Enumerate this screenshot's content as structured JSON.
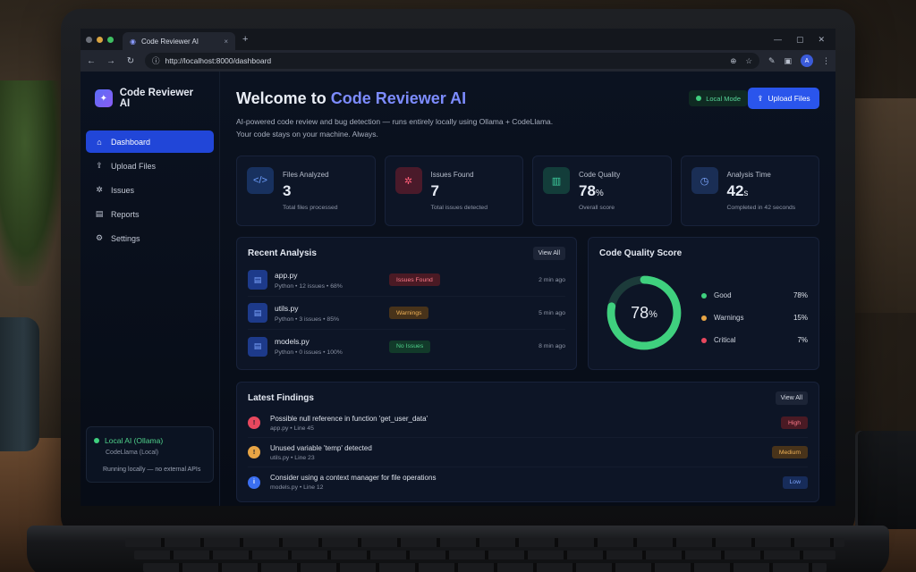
{
  "browser": {
    "tab_title": "Code Reviewer AI",
    "tab_close": "×",
    "new_tab": "+",
    "url": "http://localhost:8000/dashboard",
    "avatar_initial": "A"
  },
  "sidebar": {
    "brand": "Code Reviewer AI",
    "items": [
      {
        "label": "Dashboard"
      },
      {
        "label": "Upload Files"
      },
      {
        "label": "Issues"
      },
      {
        "label": "Reports"
      },
      {
        "label": "Settings"
      }
    ],
    "status": {
      "title": "Local AI (Ollama)",
      "model": "CodeLlama (Local)",
      "note": "Running locally — no external APIs"
    }
  },
  "header": {
    "title_prefix": "Welcome to ",
    "title_accent": "Code Reviewer AI",
    "subtitle_line1": "AI-powered code review and bug detection — runs entirely locally using Ollama + CodeLlama.",
    "subtitle_line2": "Your code stays on your machine. Always.",
    "local_mode": "Local Mode",
    "upload_button": "Upload Files"
  },
  "stats": [
    {
      "label": "Files Analyzed",
      "value": "3",
      "unit": "",
      "caption": "Total files processed"
    },
    {
      "label": "Issues Found",
      "value": "7",
      "unit": "",
      "caption": "Total issues detected"
    },
    {
      "label": "Code Quality",
      "value": "78",
      "unit": "%",
      "caption": "Overall score"
    },
    {
      "label": "Analysis Time",
      "value": "42",
      "unit": "s",
      "caption": "Completed in 42 seconds"
    }
  ],
  "recent": {
    "title": "Recent Analysis",
    "view_all": "View All",
    "rows": [
      {
        "name": "app.py",
        "meta": "Python  •  12 issues  •  68%",
        "badge": "Issues Found",
        "ago": "2 min ago"
      },
      {
        "name": "utils.py",
        "meta": "Python  •  3 issues  •  85%",
        "badge": "Warnings",
        "ago": "5 min ago"
      },
      {
        "name": "models.py",
        "meta": "Python  •  0 issues  •  100%",
        "badge": "No Issues",
        "ago": "8 min ago"
      }
    ]
  },
  "quality": {
    "title": "Code Quality Score",
    "score": "78",
    "score_unit": "%",
    "score_fraction": 0.78,
    "legend": [
      {
        "label": "Good",
        "value": "78%",
        "color": "#3fd07e"
      },
      {
        "label": "Warnings",
        "value": "15%",
        "color": "#e8a545"
      },
      {
        "label": "Critical",
        "value": "7%",
        "color": "#e8485e"
      }
    ]
  },
  "findings": {
    "title": "Latest Findings",
    "view_all": "View All",
    "rows": [
      {
        "title": "Possible null reference in function 'get_user_data'",
        "meta": "app.py  •  Line 45",
        "severity": "High"
      },
      {
        "title": "Unused variable 'temp' detected",
        "meta": "utils.py  •  Line 23",
        "severity": "Medium"
      },
      {
        "title": "Consider using a context manager for file operations",
        "meta": "models.py  •  Line 12",
        "severity": "Low"
      }
    ]
  },
  "colors": {
    "accent": "#2a55ec",
    "good": "#3fd07e",
    "warning": "#e8a545",
    "critical": "#e8485e"
  }
}
